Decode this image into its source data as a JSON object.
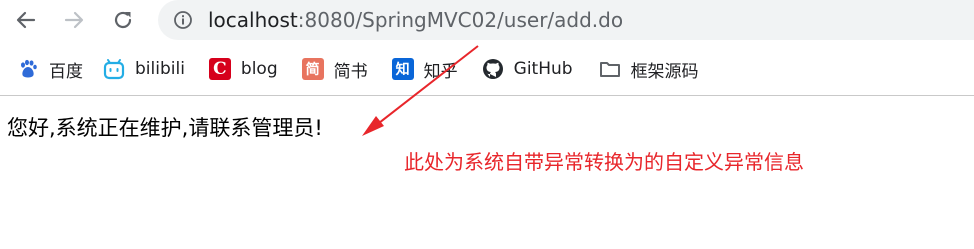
{
  "browser": {
    "back_icon": "back-arrow-icon",
    "forward_icon": "forward-arrow-icon",
    "reload_icon": "reload-icon",
    "info_icon": "site-info-icon",
    "url_host": "localhost",
    "url_path": ":8080/SpringMVC02/user/add.do"
  },
  "bookmarks": [
    {
      "icon": "baidu-paw-icon",
      "label": "百度",
      "color": "#2f6bd8"
    },
    {
      "icon": "bilibili-tv-icon",
      "label": "bilibili",
      "color": "#23ade5"
    },
    {
      "icon": "csdn-c-icon",
      "label": "blog",
      "color": "#d6001c"
    },
    {
      "icon": "jianshu-icon",
      "label": "简书",
      "color": "#e8745f"
    },
    {
      "icon": "zhihu-icon",
      "label": "知乎",
      "color": "#0a66d8"
    },
    {
      "icon": "github-icon",
      "label": "GitHub",
      "color": "#24292e"
    },
    {
      "icon": "folder-icon",
      "label": "框架源码",
      "color": "#5f6368"
    }
  ],
  "bookmark_glyphs": {
    "csdn": "C",
    "jianshu": "简",
    "zhihu": "知"
  },
  "page": {
    "message": "您好,系统正在维护,请联系管理员!"
  },
  "annotation": {
    "text": "此处为系统自带异常转换为的自定义异常信息",
    "color": "#e8262b"
  }
}
